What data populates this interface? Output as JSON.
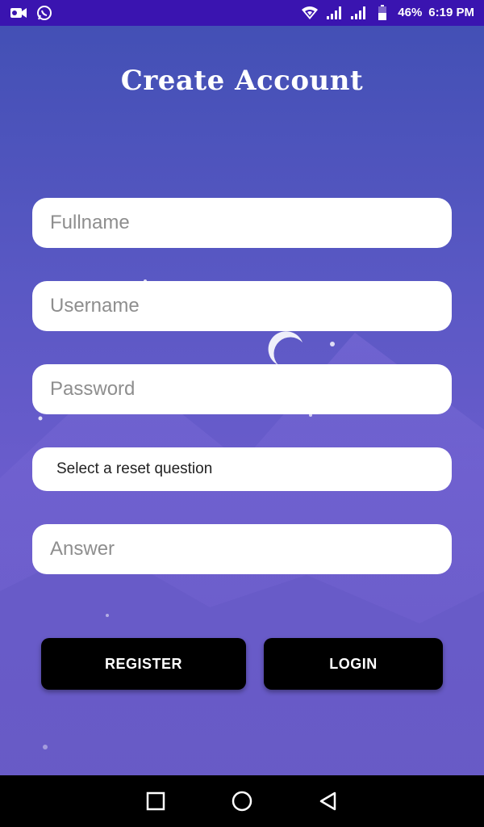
{
  "status_bar": {
    "battery_percent": "46%",
    "time": "6:19 PM",
    "left_icons": [
      "video-camera-icon",
      "whatsapp-icon"
    ],
    "right_icons": [
      "wifi-icon",
      "signal-icon",
      "signal-icon",
      "battery-icon"
    ]
  },
  "page": {
    "title": "Create Account"
  },
  "form": {
    "fullname_placeholder": "Fullname",
    "username_placeholder": "Username",
    "password_placeholder": "Password",
    "reset_question_label": "Select a reset question",
    "answer_placeholder": "Answer"
  },
  "actions": {
    "register_label": "REGISTER",
    "login_label": "LOGIN"
  },
  "nav_bar": {
    "buttons": [
      "recent-apps-icon",
      "home-icon",
      "back-icon"
    ]
  },
  "colors": {
    "status_bar": "#3a14b0",
    "background_top": "#4350b5",
    "background_bottom": "#6d5ec8",
    "button": "#000000"
  }
}
